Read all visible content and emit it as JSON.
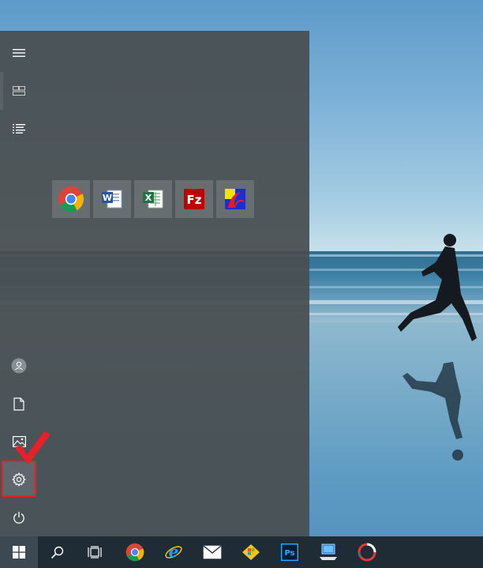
{
  "desktop": {
    "wallpaper": "beach-runner-photo"
  },
  "start_menu": {
    "rail": {
      "items": [
        {
          "name": "expand-menu",
          "icon": "hamburger-icon"
        },
        {
          "name": "pinned-tiles",
          "icon": "tiles-icon"
        },
        {
          "name": "all-apps",
          "icon": "list-icon"
        },
        {
          "name": "account",
          "icon": "user-icon"
        },
        {
          "name": "documents",
          "icon": "document-icon"
        },
        {
          "name": "pictures",
          "icon": "picture-icon"
        },
        {
          "name": "settings",
          "icon": "gear-icon"
        },
        {
          "name": "power",
          "icon": "power-icon"
        }
      ],
      "highlighted_item": "settings",
      "highlight_color": "#e8202a"
    },
    "tiles": [
      {
        "name": "google-chrome",
        "icon": "chrome-icon"
      },
      {
        "name": "microsoft-word",
        "icon": "word-icon",
        "letter": "W"
      },
      {
        "name": "microsoft-excel",
        "icon": "excel-icon",
        "letter": "X"
      },
      {
        "name": "filezilla",
        "icon": "filezilla-icon",
        "letter": "Fz"
      },
      {
        "name": "adobe-app",
        "icon": "adobe-icon"
      }
    ]
  },
  "taskbar": {
    "items": [
      {
        "name": "start",
        "icon": "windows-icon"
      },
      {
        "name": "search",
        "icon": "search-icon"
      },
      {
        "name": "task-view",
        "icon": "task-view-icon"
      },
      {
        "name": "chrome",
        "icon": "chrome-icon"
      },
      {
        "name": "internet-explorer",
        "icon": "ie-icon"
      },
      {
        "name": "mail",
        "icon": "mail-icon"
      },
      {
        "name": "store",
        "icon": "store-icon"
      },
      {
        "name": "photoshop",
        "icon": "photoshop-icon",
        "letter": "Ps"
      },
      {
        "name": "remote-desktop",
        "icon": "remote-desktop-icon"
      },
      {
        "name": "recording-app",
        "icon": "circle-app-icon"
      }
    ]
  },
  "colors": {
    "taskbar": "#1f2c36",
    "start_menu": "#484e50",
    "accent_red": "#e8202a"
  }
}
